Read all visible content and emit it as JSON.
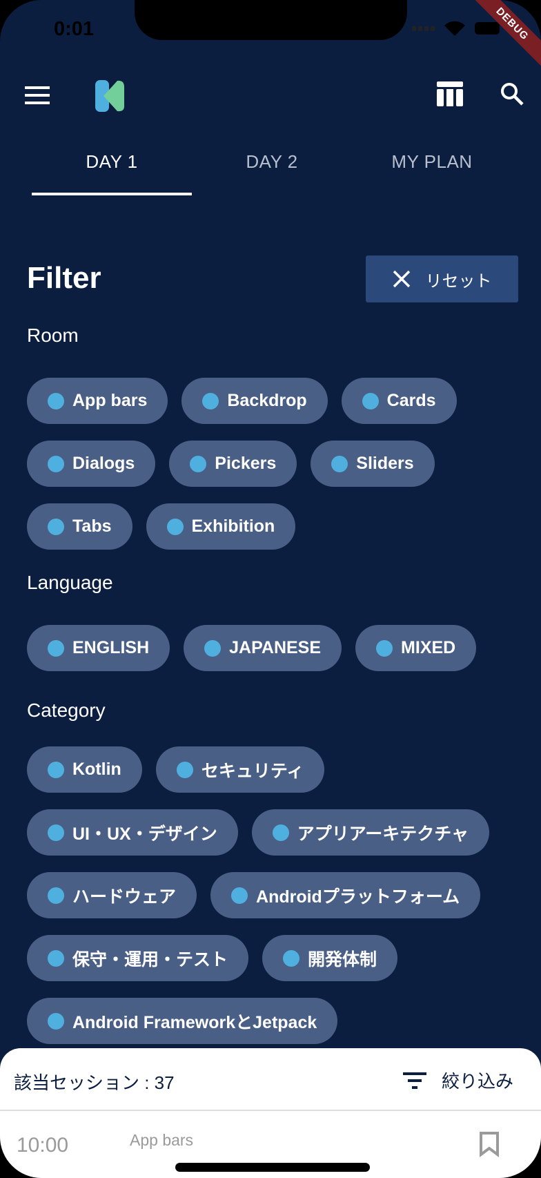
{
  "status_bar": {
    "time": "0:01",
    "debug_banner": "DEBUG"
  },
  "app_bar": {
    "menu_icon": "menu-icon",
    "logo": "droidkaigi-logo",
    "actions": [
      "timetable-icon",
      "search-icon"
    ]
  },
  "tabs": [
    {
      "label": "DAY 1",
      "active": true
    },
    {
      "label": "DAY 2",
      "active": false
    },
    {
      "label": "MY PLAN",
      "active": false
    }
  ],
  "filter": {
    "title": "Filter",
    "reset_label": "リセット",
    "sections": [
      {
        "label": "Room",
        "rows": [
          [
            "App bars",
            "Backdrop",
            "Cards"
          ],
          [
            "Dialogs",
            "Pickers",
            "Sliders"
          ],
          [
            "Tabs",
            "Exhibition"
          ]
        ]
      },
      {
        "label": "Language",
        "rows": [
          [
            "ENGLISH",
            "JAPANESE",
            "MIXED"
          ]
        ]
      },
      {
        "label": "Category",
        "rows": [
          [
            "Kotlin",
            "セキュリティ"
          ],
          [
            "UI・UX・デザイン",
            "アプリアーキテクチャ"
          ],
          [
            "ハードウェア",
            "Androidプラットフォーム"
          ],
          [
            "保守・運用・テスト",
            "開発体制"
          ],
          [
            "Android FrameworkとJetpack"
          ]
        ]
      }
    ]
  },
  "bottom_sheet": {
    "count_label": "該当セッション : 37",
    "narrow_label": "絞り込み",
    "session": {
      "time": "10:00",
      "room": "App bars"
    }
  },
  "colors": {
    "background": "#0b1e3f",
    "chip": "#4a5f86",
    "chip_dot": "#4fb0e0",
    "reset_button": "#2b4a7b",
    "debug": "#7a1f24"
  }
}
